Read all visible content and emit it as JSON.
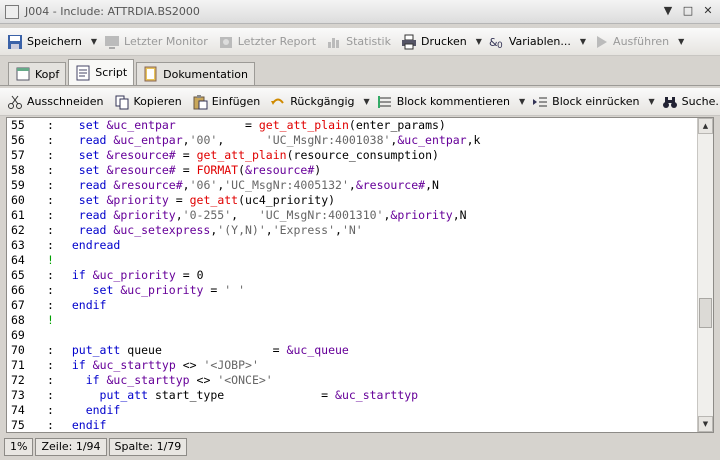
{
  "window": {
    "title": "J004 - Include: ATTRDIA.BS2000"
  },
  "toolbar_main": {
    "save": "Speichern",
    "last_monitor": "Letzter Monitor",
    "last_report": "Letzter Report",
    "statistics": "Statistik",
    "print": "Drucken",
    "variables": "Variablen...",
    "execute": "Ausführen"
  },
  "tabs": [
    {
      "label": "Kopf"
    },
    {
      "label": "Script"
    },
    {
      "label": "Dokumentation"
    }
  ],
  "toolbar_edit": {
    "cut": "Ausschneiden",
    "copy": "Kopieren",
    "paste": "Einfügen",
    "undo": "Rückgängig",
    "comment": "Block kommentieren",
    "indent": "Block einrücken",
    "search": "Suche..."
  },
  "editor": {
    "lines": [
      {
        "n": "55",
        "m": ":",
        "c": "   set &uc_entpar          = get_att_plain(enter_params)"
      },
      {
        "n": "56",
        "m": ":",
        "c": "   read &uc_entpar,'00',      'UC_MsgNr:4001038',&uc_entpar,k"
      },
      {
        "n": "57",
        "m": ":",
        "c": "   set &resource# = get_att_plain(resource_consumption)"
      },
      {
        "n": "58",
        "m": ":",
        "c": "   set &resource# = FORMAT(&resource#)"
      },
      {
        "n": "59",
        "m": ":",
        "c": "   read &resource#,'06','UC_MsgNr:4005132',&resource#,N"
      },
      {
        "n": "60",
        "m": ":",
        "c": "   set &priority = get_att(uc4_priority)"
      },
      {
        "n": "61",
        "m": ":",
        "c": "   read &priority,'0-255',   'UC_MsgNr:4001310',&priority,N"
      },
      {
        "n": "62",
        "m": ":",
        "c": "   read &uc_setexpress,'(Y,N)','Express','N'"
      },
      {
        "n": "63",
        "m": ":",
        "c": "  endread"
      },
      {
        "n": "64",
        "m": "!",
        "c": ""
      },
      {
        "n": "65",
        "m": ":",
        "c": "  if &uc_priority = 0"
      },
      {
        "n": "66",
        "m": ":",
        "c": "     set &uc_priority = ' '"
      },
      {
        "n": "67",
        "m": ":",
        "c": "  endif"
      },
      {
        "n": "68",
        "m": "!",
        "c": ""
      },
      {
        "n": "69",
        "m": "",
        "c": ""
      },
      {
        "n": "70",
        "m": ":",
        "c": "  put_att queue                = &uc_queue"
      },
      {
        "n": "71",
        "m": ":",
        "c": "  if &uc_starttyp <> '<JOBP>'"
      },
      {
        "n": "72",
        "m": ":",
        "c": "    if &uc_starttyp <> '<ONCE>'"
      },
      {
        "n": "73",
        "m": ":",
        "c": "      put_att start_type              = &uc_starttyp"
      },
      {
        "n": "74",
        "m": ":",
        "c": "    endif"
      },
      {
        "n": "75",
        "m": ":",
        "c": "  endif"
      }
    ]
  },
  "status": {
    "zoom": "1%",
    "line": "Zeile: 1/94",
    "column": "Spalte: 1/79"
  },
  "colors": {
    "keyword": "#0000cc",
    "function": "#e00000",
    "variable": "#660099",
    "string": "#666666",
    "comment_marker": "#00a000"
  }
}
